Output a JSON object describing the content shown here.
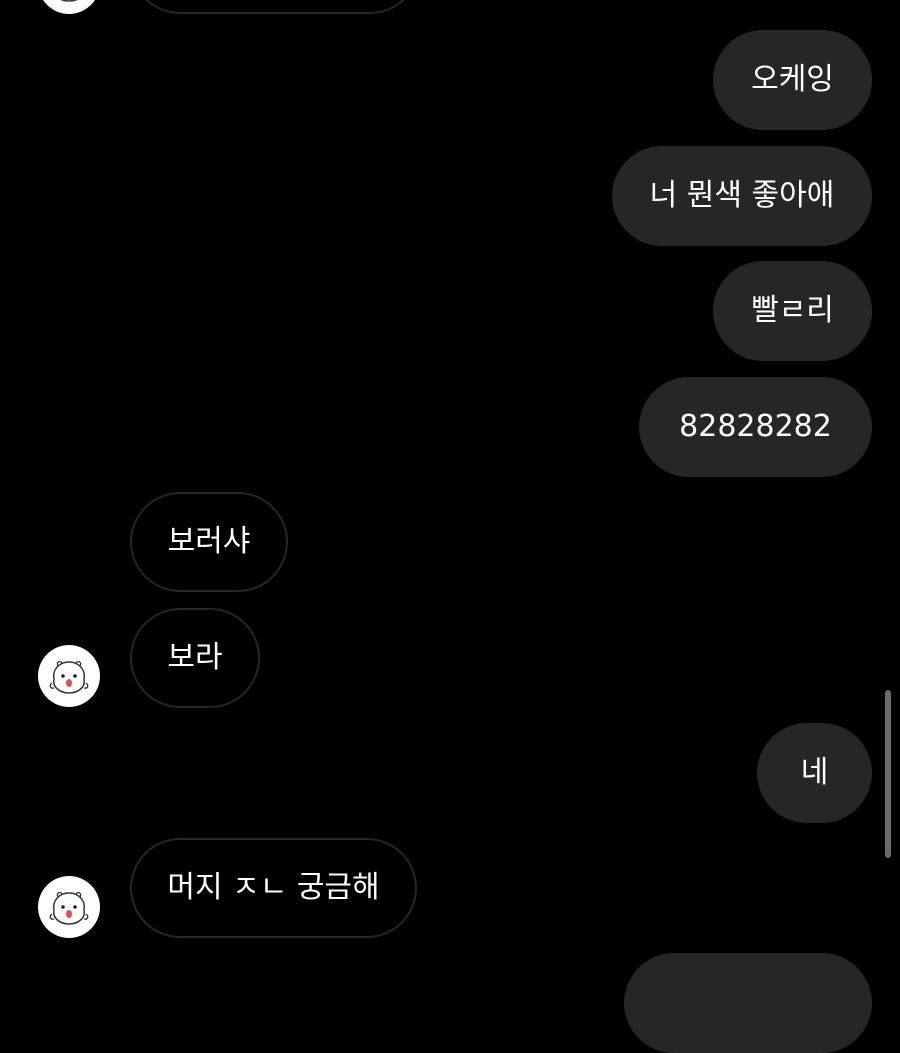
{
  "chat": {
    "theme": {
      "background": "#000000",
      "sent_bubble": "#262626",
      "received_border": "#262626",
      "text": "#ffffff"
    },
    "contact": {
      "avatar_icon": "hamster-sticker-avatar-icon"
    },
    "messages": [
      {
        "direction": "sent",
        "text": "오케잉"
      },
      {
        "direction": "sent",
        "text": "너 뭔색 좋아애"
      },
      {
        "direction": "sent",
        "text": "빨ㄹ리"
      },
      {
        "direction": "sent",
        "text": "82828282"
      },
      {
        "direction": "received",
        "text": "보러샤"
      },
      {
        "direction": "received",
        "text": "보라"
      },
      {
        "direction": "sent",
        "text": "네"
      },
      {
        "direction": "received",
        "text": "머지 ㅈㄴ 궁금해"
      }
    ]
  }
}
